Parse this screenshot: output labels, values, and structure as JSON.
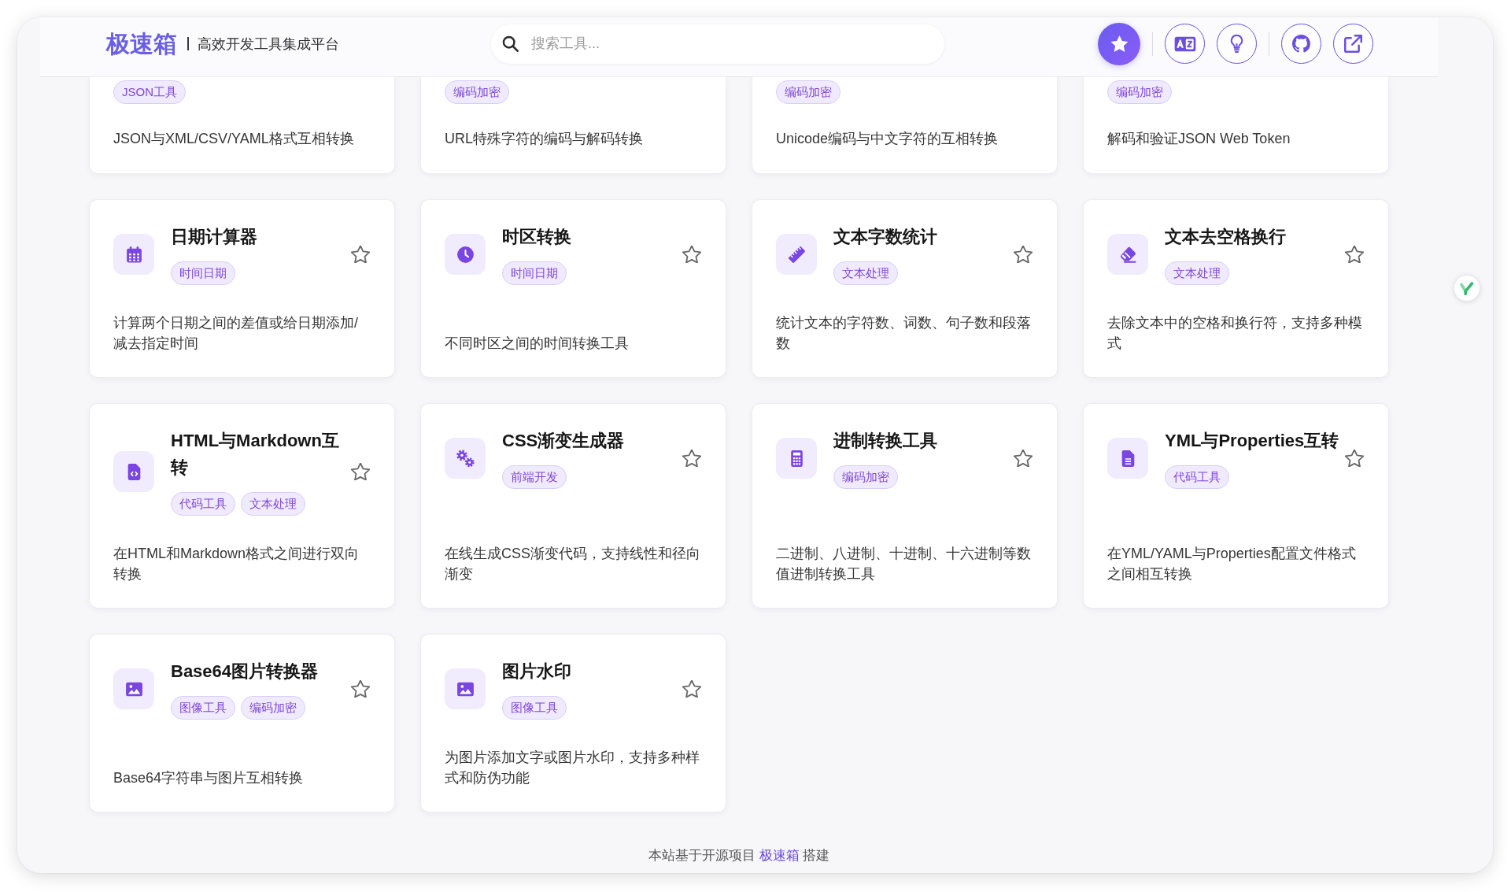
{
  "header": {
    "logo": "极速箱",
    "tagline": "高效开发工具集成平台",
    "search": {
      "placeholder": "搜索工具..."
    },
    "action_groups": [
      [
        {
          "kind": "star",
          "active": true
        }
      ],
      [
        {
          "kind": "translate",
          "active": false
        },
        {
          "kind": "lightbulb",
          "active": false
        }
      ],
      [
        {
          "kind": "github",
          "active": false
        },
        {
          "kind": "external-link",
          "active": false
        }
      ]
    ]
  },
  "partial_cards": [
    {
      "tags": [
        "JSON工具"
      ],
      "description": "JSON与XML/CSV/YAML格式互相转换"
    },
    {
      "tags": [
        "编码加密"
      ],
      "description": "URL特殊字符的编码与解码转换"
    },
    {
      "tags": [
        "编码加密"
      ],
      "description": "Unicode编码与中文字符的互相转换"
    },
    {
      "tags": [
        "编码加密"
      ],
      "description": "解码和验证JSON Web Token"
    }
  ],
  "cards": [
    {
      "kind": "calendar",
      "title": "日期计算器",
      "tags": [
        "时间日期"
      ],
      "favorite": false,
      "description": "计算两个日期之间的差值或给日期添加/减去指定时间"
    },
    {
      "kind": "clock",
      "title": "时区转换",
      "tags": [
        "时间日期"
      ],
      "favorite": false,
      "description": "不同时区之间的时间转换工具"
    },
    {
      "kind": "ruler",
      "title": "文本字数统计",
      "tags": [
        "文本处理"
      ],
      "favorite": false,
      "description": "统计文本的字符数、词数、句子数和段落数"
    },
    {
      "kind": "eraser",
      "title": "文本去空格换行",
      "tags": [
        "文本处理"
      ],
      "favorite": false,
      "description": "去除文本中的空格和换行符，支持多种模式"
    },
    {
      "kind": "file-code",
      "title": "HTML与Markdown互转",
      "tags": [
        "代码工具",
        "文本处理"
      ],
      "favorite": false,
      "description": "在HTML和Markdown格式之间进行双向转换"
    },
    {
      "kind": "gears",
      "title": "CSS渐变生成器",
      "tags": [
        "前端开发"
      ],
      "favorite": false,
      "description": "在线生成CSS渐变代码，支持线性和径向渐变"
    },
    {
      "kind": "calculator",
      "title": "进制转换工具",
      "tags": [
        "编码加密"
      ],
      "favorite": false,
      "description": "二进制、八进制、十进制、十六进制等数值进制转换工具"
    },
    {
      "kind": "file-lines",
      "title": "YML与Properties互转",
      "tags": [
        "代码工具"
      ],
      "favorite": false,
      "description": "在YML/YAML与Properties配置文件格式之间相互转换"
    },
    {
      "kind": "image",
      "title": "Base64图片转换器",
      "tags": [
        "图像工具",
        "编码加密"
      ],
      "favorite": false,
      "description": "Base64字符串与图片互相转换"
    },
    {
      "kind": "image",
      "title": "图片水印",
      "tags": [
        "图像工具"
      ],
      "favorite": false,
      "description": "为图片添加文字或图片水印，支持多种样式和防伪功能"
    }
  ],
  "footer": {
    "text_before": "本站基于开源项目",
    "link": "极速箱",
    "text_after": "搭建"
  }
}
